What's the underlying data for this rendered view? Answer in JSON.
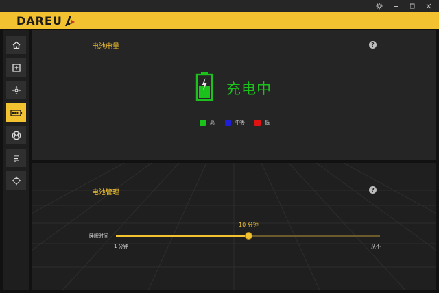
{
  "window": {
    "controls": {
      "settings_icon": "gear-icon",
      "minimize_icon": "minimize-icon",
      "maximize_icon": "maximize-icon",
      "close_icon": "close-icon"
    }
  },
  "brand": {
    "name": "DAREU",
    "color": "#f2c230"
  },
  "sidebar": {
    "items": [
      {
        "icon": "home-icon",
        "active": false
      },
      {
        "icon": "add-square-icon",
        "active": false
      },
      {
        "icon": "move-arrows-icon",
        "active": false
      },
      {
        "icon": "battery-icon",
        "active": true
      },
      {
        "icon": "macro-m-icon",
        "active": false
      },
      {
        "icon": "list-lines-icon",
        "active": false
      },
      {
        "icon": "crosshair-icon",
        "active": false
      }
    ]
  },
  "battery_level": {
    "title": "电池电量",
    "status": "充电中",
    "status_color": "#1cc21c",
    "legend": [
      {
        "label": "高",
        "color": "#1cc21c"
      },
      {
        "label": "中等",
        "color": "#1f1fd6"
      },
      {
        "label": "低",
        "color": "#e01212"
      }
    ]
  },
  "battery_management": {
    "title": "电池管理",
    "sleep_label": "睡眠时间",
    "current_value": "10 分钟",
    "min_label": "1 分钟",
    "max_label": "从不",
    "slider_fraction": 0.5
  }
}
